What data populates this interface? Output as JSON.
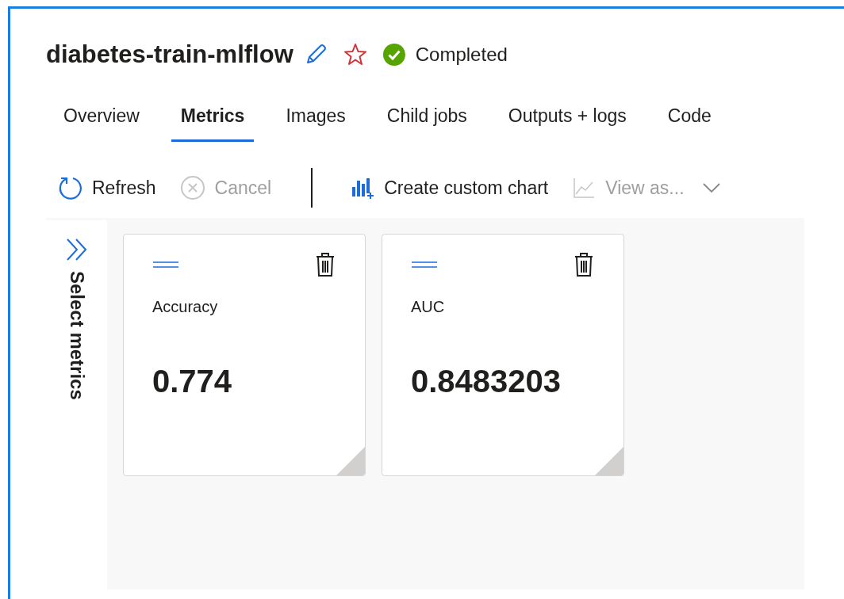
{
  "header": {
    "title": "diabetes-train-mlflow",
    "favorite": false,
    "status": "Completed"
  },
  "tabs": [
    {
      "label": "Overview",
      "selected": false
    },
    {
      "label": "Metrics",
      "selected": true
    },
    {
      "label": "Images",
      "selected": false
    },
    {
      "label": "Child jobs",
      "selected": false
    },
    {
      "label": "Outputs + logs",
      "selected": false
    },
    {
      "label": "Code",
      "selected": false
    }
  ],
  "toolbar": [
    {
      "kind": "refresh",
      "label": "Refresh",
      "disabled": false
    },
    {
      "kind": "cancel",
      "label": "Cancel",
      "disabled": true
    },
    {
      "kind": "separator"
    },
    {
      "kind": "chart",
      "label": "Create custom chart",
      "disabled": false
    },
    {
      "kind": "viewas",
      "label": "View as...",
      "disabled": true
    }
  ],
  "sidebar": {
    "label": "Select metrics"
  },
  "cards": [
    {
      "name": "Accuracy",
      "value": "0.774"
    },
    {
      "name": "AUC",
      "value": "0.8483203"
    }
  ]
}
